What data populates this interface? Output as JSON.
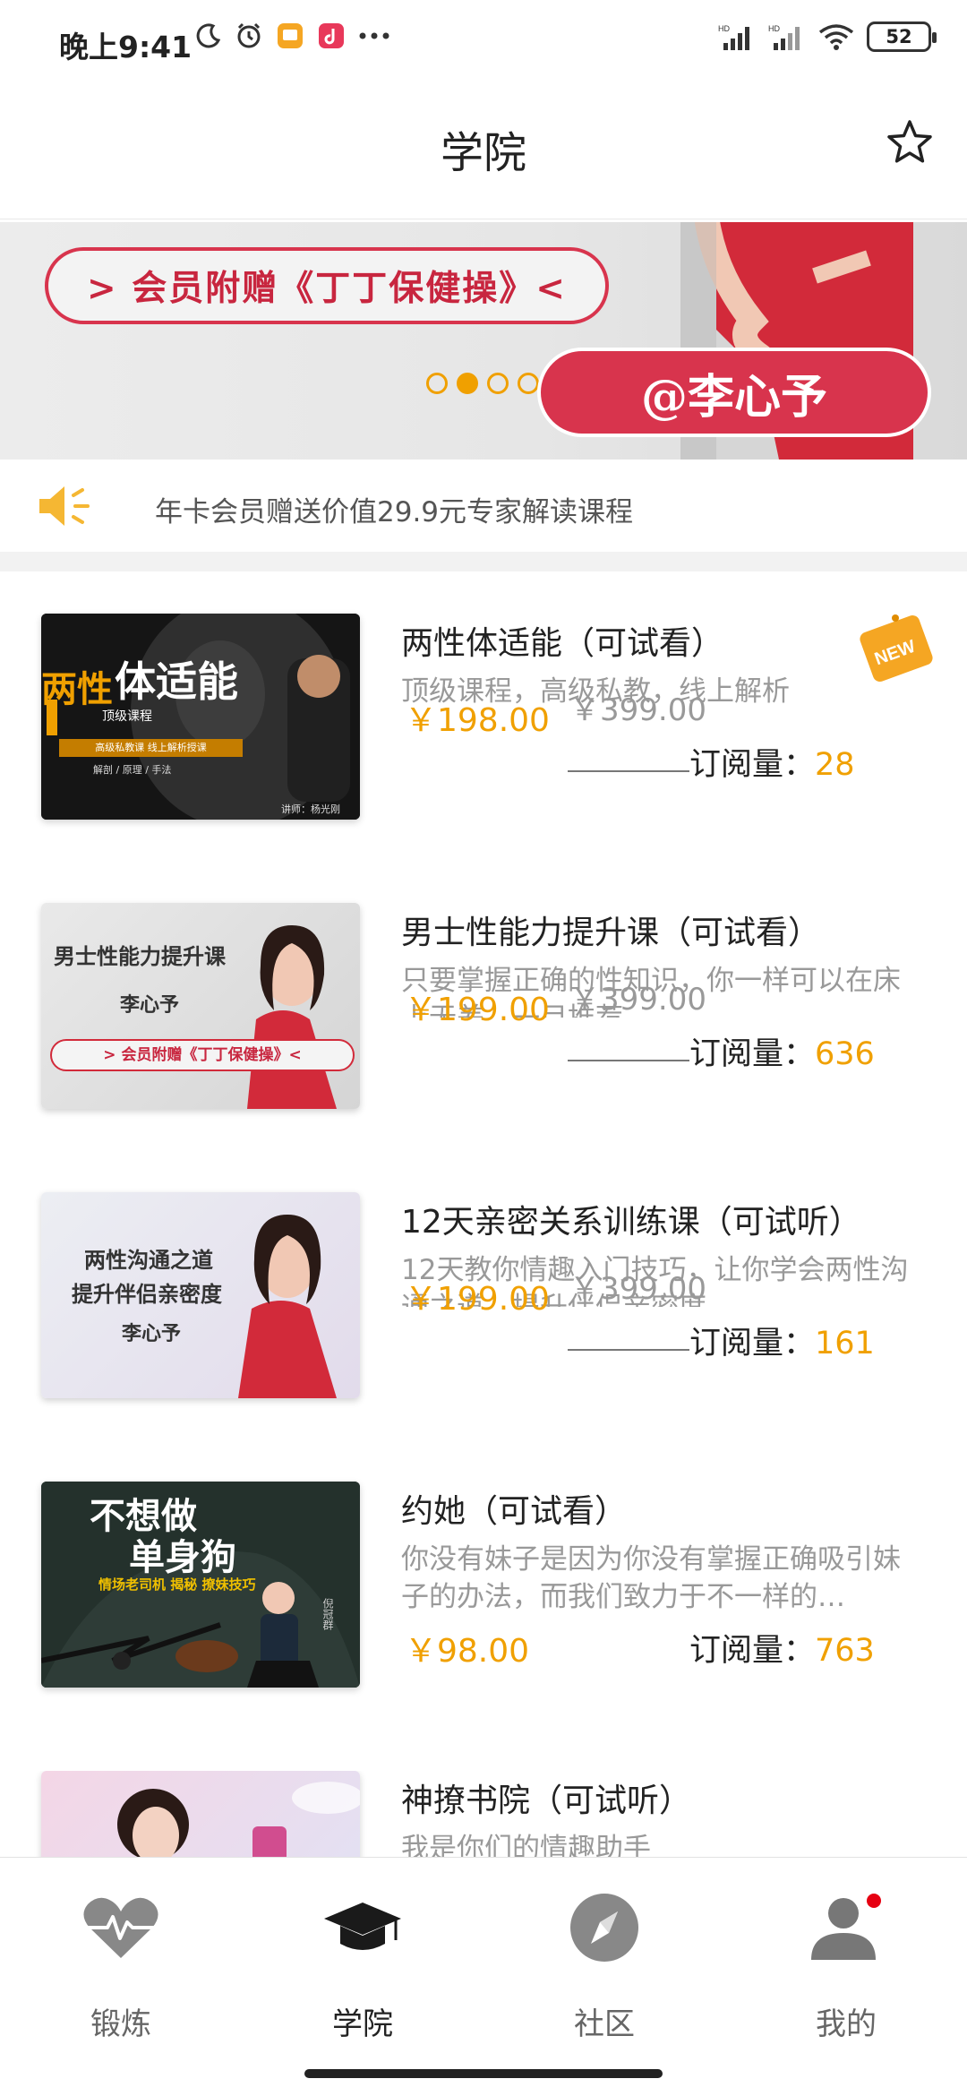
{
  "status_bar": {
    "time": "晚上9:41",
    "battery": "52",
    "signal_1": "HD",
    "signal_2": "HD"
  },
  "header": {
    "title": "学院",
    "favorite_icon": "star-outline-icon"
  },
  "banner": {
    "headline": "> 会员附赠《丁丁保健操》<",
    "name_tag": "@李心予",
    "dots_count": 4,
    "active_dot": 2
  },
  "notice": {
    "icon": "speaker-icon",
    "text": "年卡会员赠送价值29.9元专家解读课程"
  },
  "courses": [
    {
      "title": "两性体适能（可试看）",
      "desc": "顶级课程，高级私教，线上解析",
      "price": "￥198.00",
      "old_price": "￥399.00",
      "sub_label": "订阅量：",
      "sub_count": "28",
      "is_new": true,
      "new_label": "NEW",
      "thumb": {
        "title_a": "两性",
        "title_b": "体适能",
        "line1": "顶级课程",
        "line2": "高级私教课 线上解析授课",
        "line3": "解剖 / 原理 / 手法",
        "lecturer": "讲师：杨光刚"
      }
    },
    {
      "title": "男士性能力提升课（可试看）",
      "desc": "只要掌握正确的性知识，你一样可以在床上无差。一目推荐",
      "price": "￥199.00",
      "old_price": "￥399.00",
      "sub_label": "订阅量：",
      "sub_count": "636",
      "is_new": false,
      "thumb": {
        "line1": "男士性能力提升课",
        "line2": "李心予",
        "line3": "> 会员附赠《丁丁保健操》<"
      }
    },
    {
      "title": "12天亲密关系训练课（可试听）",
      "desc": "12天教你情趣入门技巧，让你学会两性沟通之道，提升伴侣亲密度",
      "price": "￥199.00",
      "old_price": "￥399.00",
      "sub_label": "订阅量：",
      "sub_count": "161",
      "is_new": false,
      "thumb": {
        "line1": "两性沟通之道",
        "line2": "提升伴侣亲密度",
        "line3": "李心予"
      }
    },
    {
      "title": "约她（可试看）",
      "desc": "你没有妹子是因为你没有掌握正确吸引妹子的办法，而我们致力于不一样的…",
      "price": "￥98.00",
      "old_price": "",
      "sub_label": "订阅量：",
      "sub_count": "763",
      "is_new": false,
      "thumb": {
        "line1": "不想做",
        "line2": "单身狗",
        "line3": "情场老司机 揭秘 撩妹技巧",
        "lecturer": "倪冠群"
      }
    },
    {
      "title": "神撩书院（可试听）",
      "desc": "我是你们的情趣助手",
      "price": "",
      "old_price": "",
      "sub_label": "",
      "sub_count": "",
      "is_new": false,
      "thumb": {}
    }
  ],
  "bottom_nav": [
    {
      "label": "锻炼",
      "icon": "heart-pulse-icon",
      "active": false
    },
    {
      "label": "学院",
      "icon": "graduation-cap-icon",
      "active": true
    },
    {
      "label": "社区",
      "icon": "compass-icon",
      "active": false
    },
    {
      "label": "我的",
      "icon": "user-icon",
      "active": false,
      "badge": true
    }
  ],
  "colors": {
    "accent": "#f0a000",
    "brand_red": "#d8344d",
    "text_primary": "#222222",
    "text_secondary": "#999999"
  }
}
